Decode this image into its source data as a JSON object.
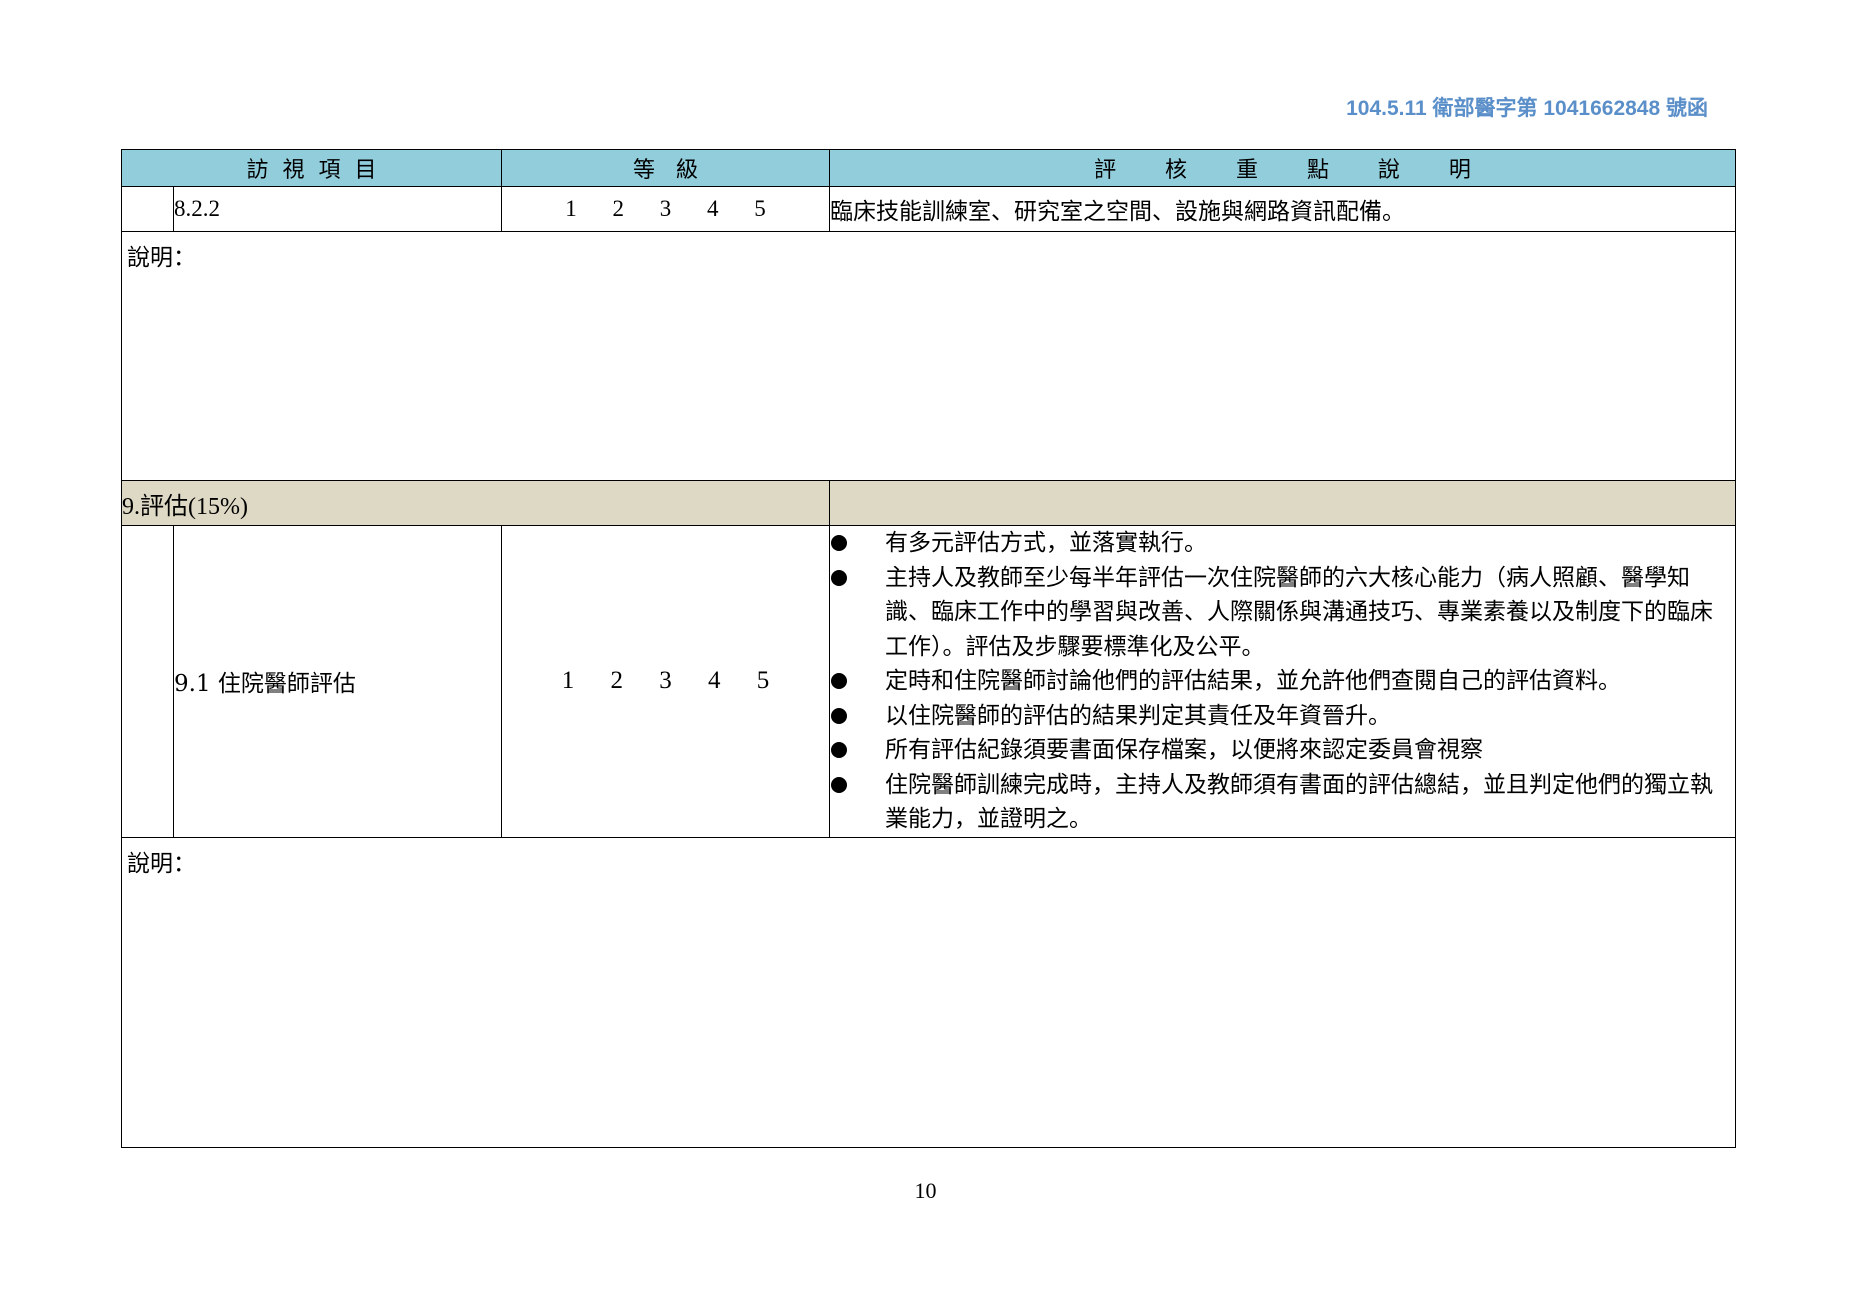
{
  "document_ref": "104.5.11 衛部醫字第 1041662848 號函",
  "table": {
    "headers": {
      "item": "訪  視  項  目",
      "grade": "等   級",
      "description": "評       核       重       點       說       明"
    },
    "row_822": {
      "code": "8.2.2",
      "grades": "1 2 3 4 5",
      "description": "臨床技能訓練室、研究室之空間、設施與網路資訊配備。"
    },
    "note_label_1": "說明：",
    "section_9": {
      "title": "9.評估(15%)"
    },
    "row_91": {
      "code": "9.1 住院醫師評估",
      "grades": "1 2 3 4 5",
      "bullets": [
        "有多元評估方式，並落實執行。",
        "主持人及教師至少每半年評估一次住院醫師的六大核心能力（病人照顧、醫學知識、臨床工作中的學習與改善、人際關係與溝通技巧、專業素養以及制度下的臨床工作）。評估及步驟要標準化及公平。",
        "定時和住院醫師討論他們的評估結果，並允許他們查閱自己的評估資料。",
        "以住院醫師的評估的結果判定其責任及年資晉升。",
        "所有評估紀錄須要書面保存檔案，以便將來認定委員會視察",
        "住院醫師訓練完成時，主持人及教師須有書面的評估總結，並且判定他們的獨立執業能力，並證明之。"
      ]
    },
    "note_label_2": "說明："
  },
  "page_number": "10"
}
